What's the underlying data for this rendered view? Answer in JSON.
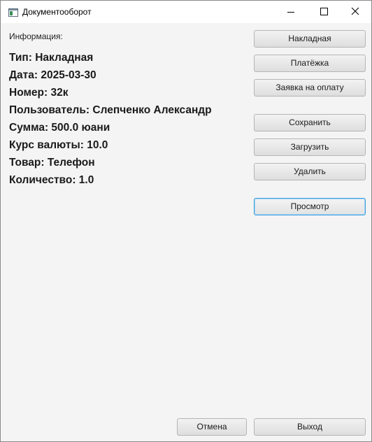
{
  "window": {
    "title": "Документооборот"
  },
  "info": {
    "label": "Информация:",
    "lines": [
      "Тип: Накладная",
      "Дата: 2025-03-30",
      "Номер: 32к",
      "Пользователь: Слепченко Александр",
      "Сумма: 500.0 юани",
      "Курс валюты: 10.0",
      "Товар: Телефон",
      "Количество: 1.0"
    ]
  },
  "buttons": {
    "invoice": "Накладная",
    "payment": "Платёжка",
    "payment_request": "Заявка на оплату",
    "save": "Сохранить",
    "load": "Загрузить",
    "delete": "Удалить",
    "view": "Просмотр",
    "cancel": "Отмена",
    "exit": "Выход"
  },
  "icons": {
    "app": "app-window-icon",
    "minimize": "minimize-icon",
    "maximize": "maximize-icon",
    "close": "close-icon"
  }
}
